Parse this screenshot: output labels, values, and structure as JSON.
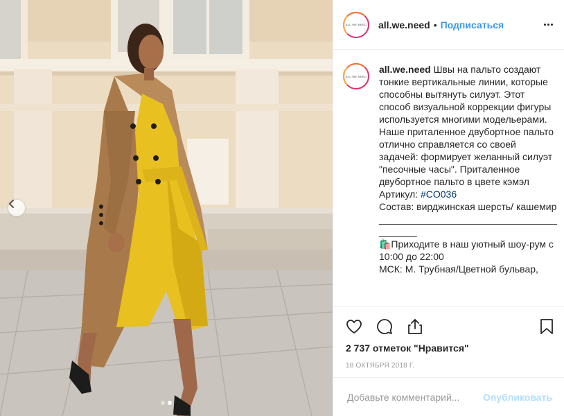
{
  "post": {
    "username": "all.we.need",
    "separator": "•",
    "follow_label": "Подписаться",
    "avatar_text": "ALL.WE.NEED",
    "caption": {
      "username": "all.we.need",
      "text_before_tag": " Швы на пальто создают тонкие вертикальные линии, которые способны вытянуть силуэт. Этот способ визуальной коррекции фигуры используется многими модельерами. Наше приталенное двубортное пальто отлично справляется со своей задачей: формирует желанный силуэт \"песочные часы\". Приталенное двубортное пальто в цвете кэмэл\nАртикул: ",
      "hashtag": "#CO036",
      "text_after_tag": "\nСостав: вирджинская шерсть/ кашемир\n________________________________________\n🛍️Приходите в наш уютный шоу-рум с 10:00 до 22:00\nМСК: М. Трубная/Цветной бульвар,"
    },
    "likes_text": "2 737 отметок \"Нравится\"",
    "date_text": "18 октября 2018 г.",
    "comment_placeholder": "Добавьте комментарий...",
    "publish_label": "Опубликовать",
    "carousel": {
      "slides": 2,
      "active_index": 1
    },
    "icons": {
      "like": "heart-icon",
      "comment": "comment-icon",
      "share": "share-icon",
      "save": "bookmark-icon",
      "more": "more-dots-icon",
      "prev": "chevron-left-icon"
    },
    "colors": {
      "accent": "#3897f0",
      "hashtag": "#003569",
      "publish_disabled": "#b2dffc",
      "muted": "#999999",
      "dress": "#e8c020",
      "coat": "#b98a5a"
    }
  }
}
